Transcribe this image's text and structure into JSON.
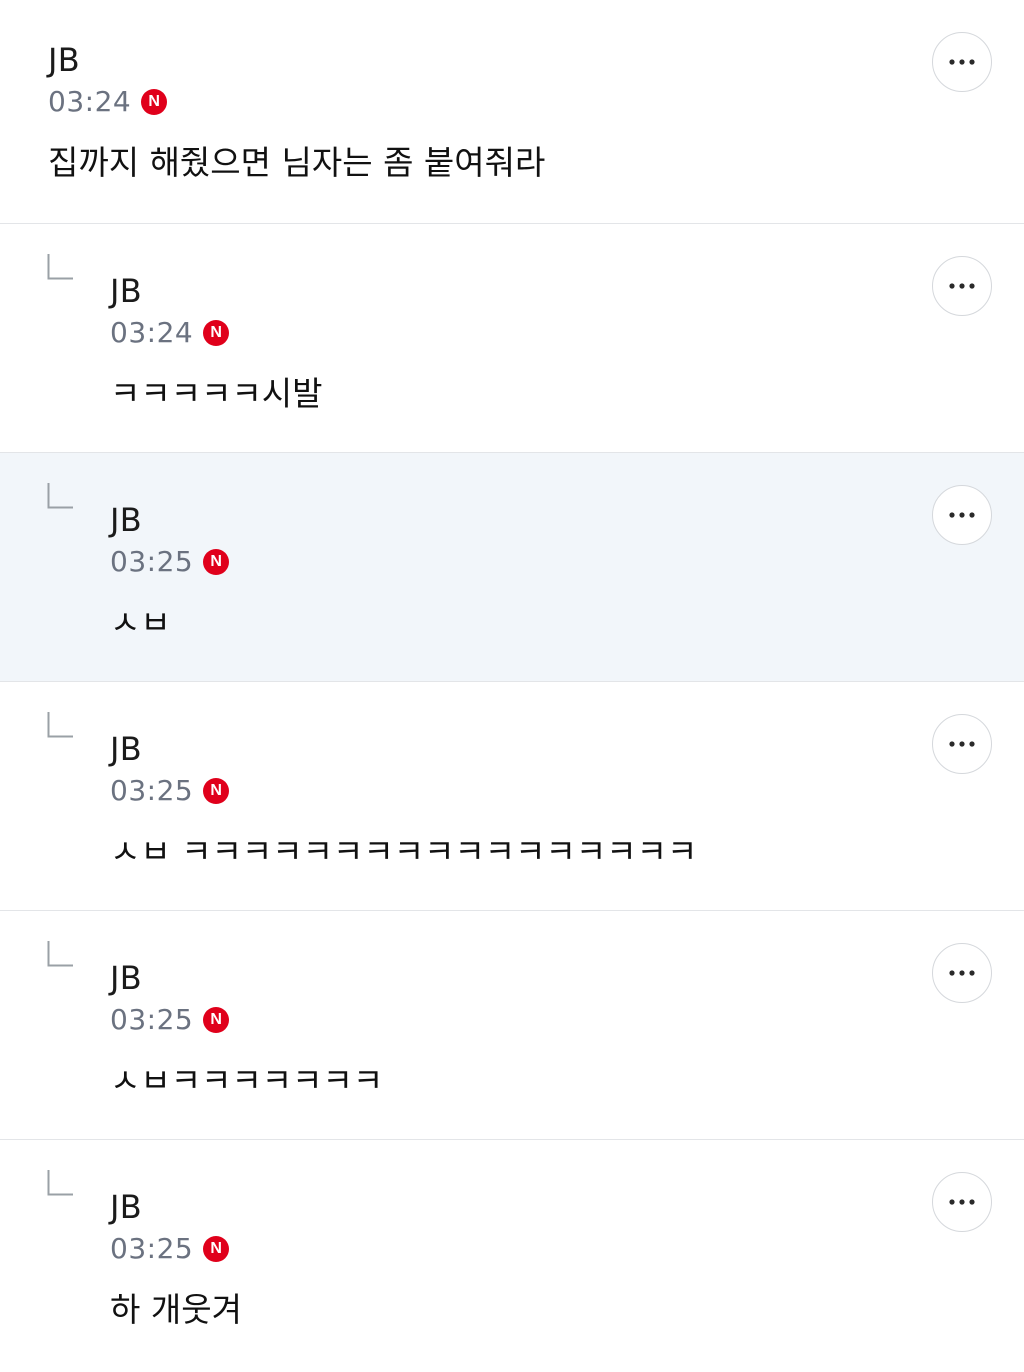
{
  "comments": [
    {
      "author": "JB",
      "time": "03:24",
      "badge": "N",
      "text": "집까지 해줬으면 님자는 좀 붙여줘라",
      "is_reply": false,
      "highlighted": false
    },
    {
      "author": "JB",
      "time": "03:24",
      "badge": "N",
      "text": "ㅋㅋㅋㅋㅋ시발",
      "is_reply": true,
      "highlighted": false
    },
    {
      "author": "JB",
      "time": "03:25",
      "badge": "N",
      "text": "ㅅㅂ",
      "is_reply": true,
      "highlighted": true
    },
    {
      "author": "JB",
      "time": "03:25",
      "badge": "N",
      "text": "ㅅㅂ ㅋㅋㅋㅋㅋㅋㅋㅋㅋㅋㅋㅋㅋㅋㅋㅋㅋ",
      "is_reply": true,
      "highlighted": false
    },
    {
      "author": "JB",
      "time": "03:25",
      "badge": "N",
      "text": "ㅅㅂㅋㅋㅋㅋㅋㅋㅋ",
      "is_reply": true,
      "highlighted": false
    },
    {
      "author": "JB",
      "time": "03:25",
      "badge": "N",
      "text": "하 개웃겨",
      "is_reply": true,
      "highlighted": false
    }
  ],
  "icons": {
    "reply": "reply-arrow-icon",
    "more": "more-horizontal-icon",
    "new": "new-badge-icon"
  },
  "colors": {
    "badge": "#e0001b",
    "highlight_bg": "#f2f6fa",
    "divider": "#e3e5e8",
    "meta_text": "#6b7280"
  }
}
